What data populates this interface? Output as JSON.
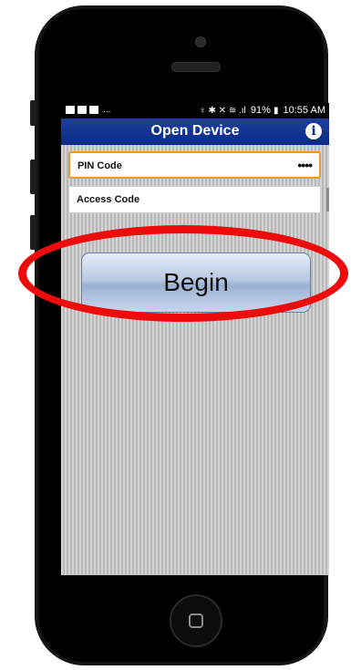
{
  "statusbar": {
    "notification_overflow": "...",
    "right_text": "♀ ✱ ✕ ≋ .ıl 91% ▮ 10:55 AM",
    "battery": "91%",
    "time": "10:55 AM"
  },
  "header": {
    "title": "Open Device",
    "info_icon": "i"
  },
  "form": {
    "pin_label": "PIN Code",
    "pin_value": "••••",
    "access_label": "Access Code",
    "access_value": ""
  },
  "actions": {
    "begin_label": "Begin"
  },
  "colors": {
    "titlebar": "#0a2a8a",
    "focus_border": "#f0962a",
    "highlight_ring": "#ee0b0b"
  }
}
